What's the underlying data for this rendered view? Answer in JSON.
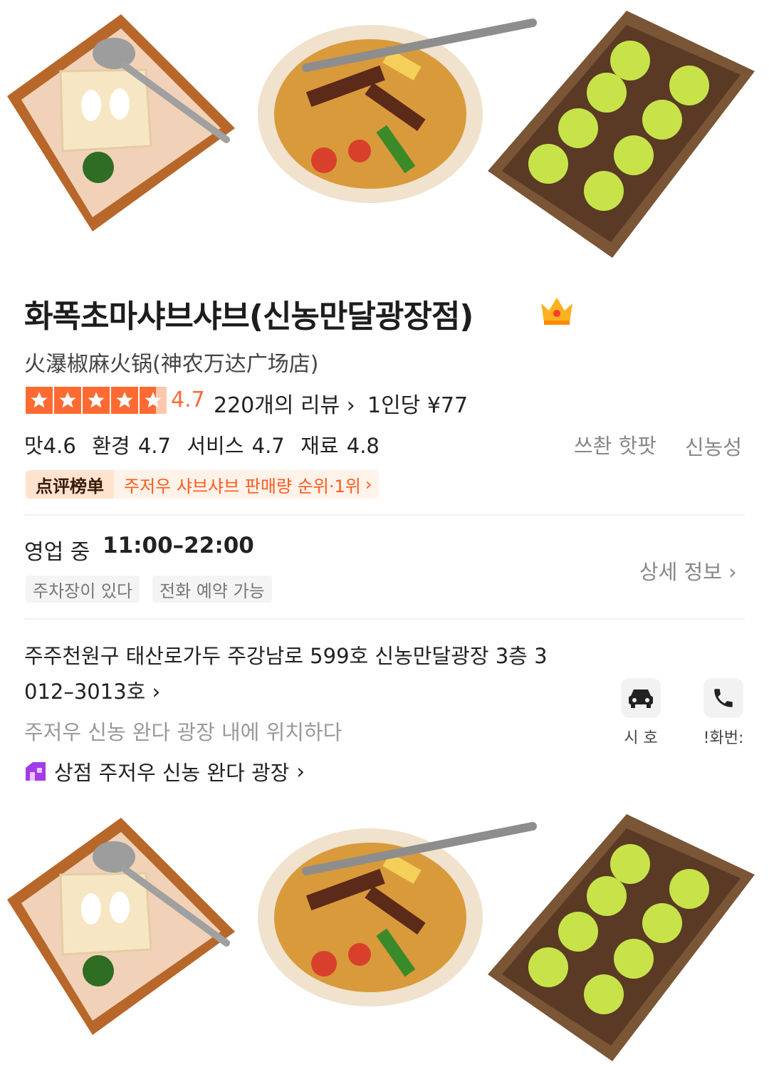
{
  "store": {
    "name_ko": "화폭초마샤브샤브(신농만달광장점)",
    "name_cn": "火瀑椒麻火锅(神农万达广场店)",
    "rating": "4.7",
    "review_count": "220개의 리뷰",
    "per_person": "1인당 ¥77",
    "scores": "맛4.6  환경 4.7  서비스 4.7  재료 4.8",
    "tags": [
      "쓰촨 핫팟",
      "신농성"
    ],
    "ranking_badge": "点评榜单",
    "ranking_text": "주저우 샤브샤브 판매량 순위·1위",
    "status": "영업 중",
    "hours": "11:00–22:00",
    "features": [
      "주차장이 있다",
      "전화 예약 가능"
    ],
    "details_link": "상세 정보",
    "address_line1": "주주천원구 태산로가두 주강남로 599호 신농만달광장 3층 3",
    "address_line2": "012–3013호",
    "location_note": "주저우 신농 완다 광장 내에 위치하다",
    "mall_link": "상점 주저우 신농 완다 광장"
  },
  "actions": [
    {
      "label": "시 호",
      "icon": "car-icon"
    },
    {
      "label": "!화번:",
      "icon": "phone-icon"
    }
  ],
  "food_illustrations": [
    "tofu-tray",
    "rice-bowl",
    "green-balls-tray"
  ],
  "colors": {
    "accent": "#ff6a33",
    "rank_text": "#ff5a1f",
    "mall_icon": "#a43be8"
  }
}
